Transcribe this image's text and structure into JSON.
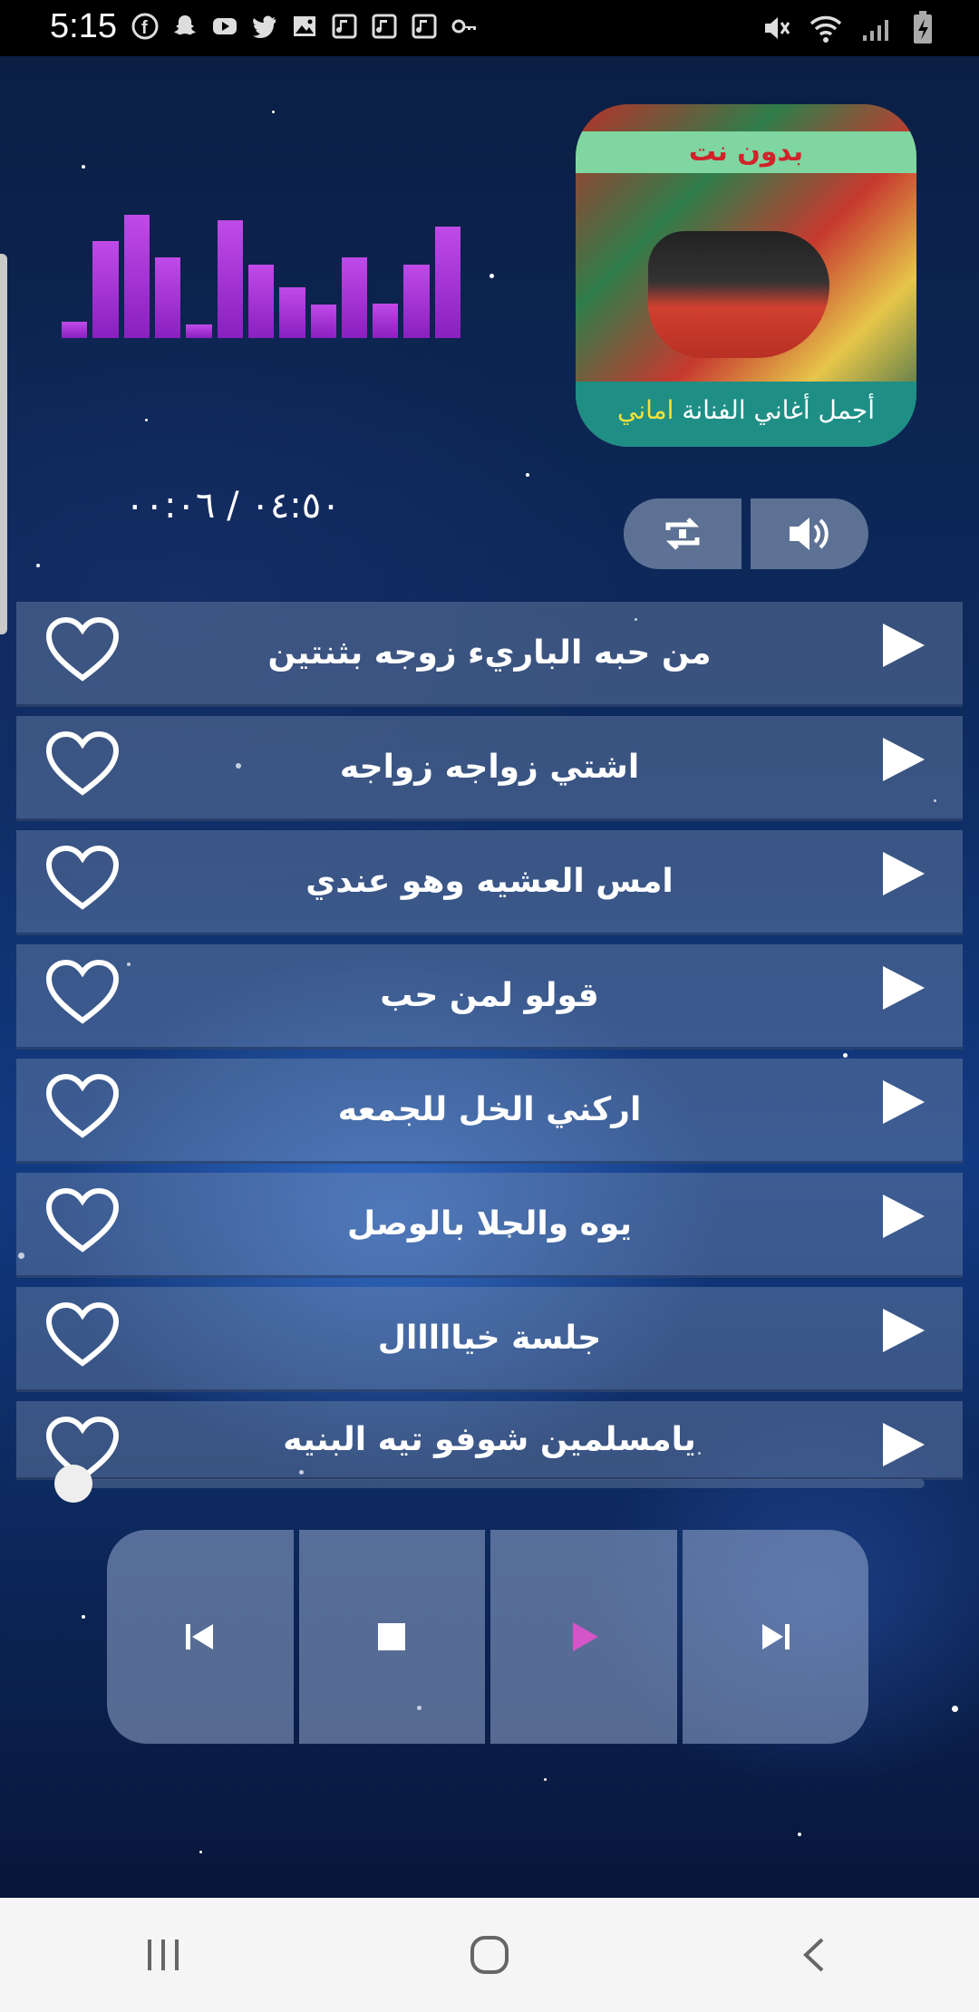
{
  "status_bar": {
    "time": "5:15",
    "left_icons": [
      "facebook-icon",
      "snapchat-icon",
      "youtube-icon",
      "twitter-icon",
      "image-icon",
      "music-icon",
      "music-icon",
      "music-icon",
      "key-icon"
    ],
    "right_icons": [
      "mute-icon",
      "wifi-icon",
      "signal-icon",
      "battery-charging-icon"
    ]
  },
  "cover": {
    "top_label": "بدون نت",
    "bottom_label_prefix": "أجمل أغاني الفنانة",
    "bottom_label_highlight": "اماني"
  },
  "player_time": "٠٤:٥٠ / ٠٠:٠٦",
  "equalizer_levels": [
    0.12,
    0.72,
    0.92,
    0.6,
    0.1,
    0.88,
    0.55,
    0.38,
    0.25,
    0.6,
    0.26,
    0.55,
    0.83
  ],
  "controls": {
    "repeat_icon": "repeat-icon",
    "volume_icon": "volume-icon"
  },
  "songs": [
    {
      "title": "من حبه الباريء زوجه بثنتين"
    },
    {
      "title": "اشتي زواجه زواجه"
    },
    {
      "title": "امس العشيه وهو عندي"
    },
    {
      "title": "قولو لمن حب"
    },
    {
      "title": "اركني الخل للجمعه"
    },
    {
      "title": "يوه والحلا بالوصل"
    },
    {
      "title": "جلسة خيااااال"
    },
    {
      "title": "يامسلمين شوفو تيه البنيه"
    }
  ],
  "seek_progress": 0.0,
  "player_buttons": [
    "previous-icon",
    "stop-icon",
    "play-icon",
    "next-icon"
  ],
  "colors": {
    "equalizer": "#b030e0",
    "play_accent": "#d455c8",
    "cover_top_bg": "#7fd6a0",
    "cover_bottom_bg": "#1f8f86"
  },
  "nav_bar": [
    "recents-icon",
    "home-icon",
    "back-icon"
  ]
}
